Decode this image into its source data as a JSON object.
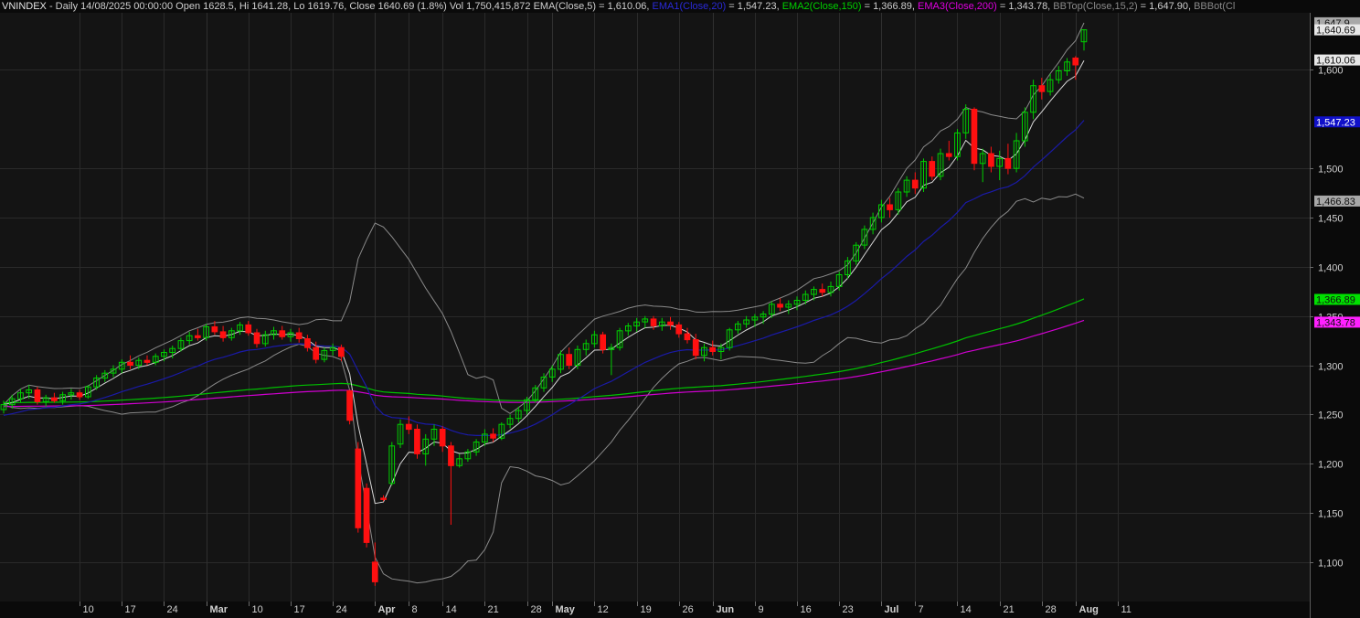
{
  "header": {
    "symbol": "VNINDEX",
    "info": " - Daily 14/08/2025 00:00:00 Open 1628.5, Hi 1641.28, Lo 1619.76, Close 1640.69 (1.8%) Vol 1,750,415,872 ",
    "ind1_label": "EMA(Close,5)",
    "ind1_value": " = 1,610.06, ",
    "ind2_label": "EMA1(Close,20)",
    "ind2_value": " = 1,547.23, ",
    "ind3_label": "EMA2(Close,150)",
    "ind3_value": " = 1,366.89, ",
    "ind4_label": "EMA3(Close,200)",
    "ind4_value": " = 1,343.78, ",
    "ind5_label": "BBTop(Close,15,2)",
    "ind5_value": " = 1,647.90, ",
    "ind6_label": "BBBot(Cl"
  },
  "colors": {
    "background": "#0a0a0a",
    "panel": "#141414",
    "grid": "#2a2a2a",
    "up": "#00d000",
    "down": "#ff1010",
    "ema5": "#d8d8d8",
    "ema20": "#1a1aa8",
    "ema150": "#00c000",
    "ema200": "#d000d0",
    "bb": "#8a8a8a",
    "axis_text": "#d0d0d0"
  },
  "chart_data": {
    "type": "candlestick",
    "y_range": [
      1060,
      1658
    ],
    "y_ticks": [
      {
        "value": 1100,
        "label": "1,100"
      },
      {
        "value": 1150,
        "label": "1,150"
      },
      {
        "value": 1200,
        "label": "1,200"
      },
      {
        "value": 1250,
        "label": "1,250"
      },
      {
        "value": 1300,
        "label": "1,300"
      },
      {
        "value": 1350,
        "label": "1,350"
      },
      {
        "value": 1400,
        "label": "1,400"
      },
      {
        "value": 1450,
        "label": "1,450"
      },
      {
        "value": 1500,
        "label": "1,500"
      },
      {
        "value": 1600,
        "label": "1,600"
      }
    ],
    "x_ticks": [
      {
        "label": "10",
        "major": false
      },
      {
        "label": "17",
        "major": false
      },
      {
        "label": "24",
        "major": false
      },
      {
        "label": "Mar",
        "major": true
      },
      {
        "label": "10",
        "major": false
      },
      {
        "label": "17",
        "major": false
      },
      {
        "label": "24",
        "major": false
      },
      {
        "label": "Apr",
        "major": true
      },
      {
        "label": "8",
        "major": false
      },
      {
        "label": "14",
        "major": false
      },
      {
        "label": "21",
        "major": false
      },
      {
        "label": "28",
        "major": false
      },
      {
        "label": "May",
        "major": true
      },
      {
        "label": "12",
        "major": false
      },
      {
        "label": "19",
        "major": false
      },
      {
        "label": "26",
        "major": false
      },
      {
        "label": "Jun",
        "major": true
      },
      {
        "label": "9",
        "major": false
      },
      {
        "label": "16",
        "major": false
      },
      {
        "label": "23",
        "major": false
      },
      {
        "label": "Jul",
        "major": true
      },
      {
        "label": "7",
        "major": false
      },
      {
        "label": "14",
        "major": false
      },
      {
        "label": "21",
        "major": false
      },
      {
        "label": "28",
        "major": false
      },
      {
        "label": "Aug",
        "major": true
      },
      {
        "label": "11",
        "major": false
      }
    ],
    "price_tags": [
      {
        "value": 1647.9,
        "label": "1,647.9",
        "color": "#a8a8a8",
        "text": "#111111"
      },
      {
        "value": 1640.69,
        "label": "1,640.69",
        "color": "#e8e8e8",
        "text": "#111111"
      },
      {
        "value": 1610.06,
        "label": "1,610.06",
        "color": "#e8e8e8",
        "text": "#111111"
      },
      {
        "value": 1547.23,
        "label": "1,547.23",
        "color": "#1010c8",
        "text": "#ffffff"
      },
      {
        "value": 1466.83,
        "label": "1,466.83",
        "color": "#a8a8a8",
        "text": "#111111"
      },
      {
        "value": 1366.89,
        "label": "1,366.89",
        "color": "#00e000",
        "text": "#111111"
      },
      {
        "value": 1343.78,
        "label": "1,343.78",
        "color": "#ff20ff",
        "text": "#111111"
      }
    ],
    "ohlc_approx": [
      [
        1255,
        1264,
        1251,
        1260
      ],
      [
        1260,
        1270,
        1256,
        1266
      ],
      [
        1266,
        1276,
        1262,
        1272
      ],
      [
        1272,
        1280,
        1266,
        1275
      ],
      [
        1275,
        1278,
        1260,
        1263
      ],
      [
        1263,
        1270,
        1258,
        1267
      ],
      [
        1267,
        1272,
        1262,
        1264
      ],
      [
        1264,
        1273,
        1260,
        1270
      ],
      [
        1270,
        1276,
        1265,
        1272
      ],
      [
        1272,
        1275,
        1265,
        1268
      ],
      [
        1268,
        1280,
        1266,
        1278
      ],
      [
        1278,
        1290,
        1275,
        1287
      ],
      [
        1287,
        1295,
        1283,
        1292
      ],
      [
        1292,
        1300,
        1288,
        1296
      ],
      [
        1296,
        1306,
        1292,
        1303
      ],
      [
        1303,
        1310,
        1296,
        1300
      ],
      [
        1300,
        1308,
        1296,
        1305
      ],
      [
        1305,
        1310,
        1300,
        1303
      ],
      [
        1303,
        1312,
        1300,
        1309
      ],
      [
        1309,
        1316,
        1304,
        1313
      ],
      [
        1313,
        1320,
        1307,
        1317
      ],
      [
        1317,
        1328,
        1314,
        1325
      ],
      [
        1325,
        1334,
        1321,
        1330
      ],
      [
        1330,
        1337,
        1325,
        1328
      ],
      [
        1328,
        1342,
        1325,
        1339
      ],
      [
        1339,
        1345,
        1331,
        1334
      ],
      [
        1334,
        1340,
        1324,
        1328
      ],
      [
        1328,
        1338,
        1325,
        1335
      ],
      [
        1335,
        1344,
        1331,
        1341
      ],
      [
        1341,
        1345,
        1330,
        1333
      ],
      [
        1333,
        1337,
        1318,
        1322
      ],
      [
        1322,
        1335,
        1319,
        1331
      ],
      [
        1331,
        1339,
        1326,
        1335
      ],
      [
        1335,
        1340,
        1326,
        1329
      ],
      [
        1329,
        1337,
        1324,
        1333
      ],
      [
        1333,
        1338,
        1323,
        1327
      ],
      [
        1327,
        1331,
        1314,
        1318
      ],
      [
        1318,
        1324,
        1302,
        1306
      ],
      [
        1306,
        1318,
        1303,
        1315
      ],
      [
        1315,
        1322,
        1310,
        1318
      ],
      [
        1318,
        1321,
        1304,
        1309
      ],
      [
        1274,
        1275,
        1240,
        1244
      ],
      [
        1215,
        1222,
        1130,
        1135
      ],
      [
        1175,
        1180,
        1115,
        1120
      ],
      [
        1100,
        1120,
        1076,
        1080
      ],
      [
        1165,
        1168,
        1162,
        1164
      ],
      [
        1180,
        1222,
        1178,
        1218
      ],
      [
        1220,
        1245,
        1216,
        1240
      ],
      [
        1240,
        1248,
        1230,
        1235
      ],
      [
        1235,
        1240,
        1205,
        1210
      ],
      [
        1210,
        1230,
        1198,
        1225
      ],
      [
        1225,
        1240,
        1218,
        1235
      ],
      [
        1235,
        1238,
        1212,
        1218
      ],
      [
        1218,
        1222,
        1138,
        1198
      ],
      [
        1198,
        1210,
        1196,
        1205
      ],
      [
        1205,
        1215,
        1202,
        1212
      ],
      [
        1212,
        1225,
        1208,
        1222
      ],
      [
        1222,
        1235,
        1218,
        1230
      ],
      [
        1230,
        1236,
        1222,
        1226
      ],
      [
        1226,
        1242,
        1224,
        1240
      ],
      [
        1240,
        1250,
        1236,
        1246
      ],
      [
        1246,
        1258,
        1242,
        1254
      ],
      [
        1254,
        1268,
        1250,
        1265
      ],
      [
        1265,
        1280,
        1262,
        1277
      ],
      [
        1277,
        1292,
        1273,
        1288
      ],
      [
        1288,
        1300,
        1283,
        1296
      ],
      [
        1296,
        1315,
        1292,
        1311
      ],
      [
        1311,
        1318,
        1296,
        1300
      ],
      [
        1300,
        1320,
        1296,
        1316
      ],
      [
        1316,
        1326,
        1310,
        1322
      ],
      [
        1322,
        1335,
        1318,
        1331
      ],
      [
        1331,
        1334,
        1312,
        1316
      ],
      [
        1316,
        1322,
        1290,
        1318
      ],
      [
        1318,
        1338,
        1315,
        1335
      ],
      [
        1335,
        1343,
        1330,
        1340
      ],
      [
        1340,
        1348,
        1334,
        1344
      ],
      [
        1344,
        1350,
        1338,
        1347
      ],
      [
        1347,
        1350,
        1336,
        1340
      ],
      [
        1340,
        1348,
        1335,
        1344
      ],
      [
        1344,
        1349,
        1336,
        1341
      ],
      [
        1341,
        1344,
        1328,
        1332
      ],
      [
        1332,
        1338,
        1322,
        1326
      ],
      [
        1326,
        1332,
        1306,
        1310
      ],
      [
        1310,
        1322,
        1304,
        1318
      ],
      [
        1318,
        1325,
        1310,
        1314
      ],
      [
        1314,
        1322,
        1306,
        1318
      ],
      [
        1318,
        1338,
        1315,
        1336
      ],
      [
        1336,
        1345,
        1332,
        1342
      ],
      [
        1342,
        1350,
        1338,
        1346
      ],
      [
        1346,
        1352,
        1339,
        1349
      ],
      [
        1349,
        1355,
        1342,
        1352
      ],
      [
        1352,
        1365,
        1348,
        1362
      ],
      [
        1362,
        1368,
        1355,
        1359
      ],
      [
        1359,
        1366,
        1352,
        1362
      ],
      [
        1362,
        1370,
        1356,
        1366
      ],
      [
        1366,
        1376,
        1362,
        1372
      ],
      [
        1372,
        1380,
        1366,
        1377
      ],
      [
        1377,
        1383,
        1370,
        1374
      ],
      [
        1374,
        1385,
        1370,
        1380
      ],
      [
        1380,
        1395,
        1376,
        1392
      ],
      [
        1392,
        1410,
        1388,
        1406
      ],
      [
        1406,
        1425,
        1402,
        1422
      ],
      [
        1422,
        1442,
        1418,
        1438
      ],
      [
        1438,
        1455,
        1433,
        1450
      ],
      [
        1450,
        1468,
        1445,
        1463
      ],
      [
        1463,
        1470,
        1450,
        1458
      ],
      [
        1458,
        1480,
        1453,
        1476
      ],
      [
        1476,
        1492,
        1471,
        1488
      ],
      [
        1488,
        1496,
        1474,
        1480
      ],
      [
        1480,
        1510,
        1476,
        1507
      ],
      [
        1507,
        1512,
        1488,
        1492
      ],
      [
        1492,
        1520,
        1488,
        1515
      ],
      [
        1515,
        1528,
        1508,
        1512
      ],
      [
        1512,
        1540,
        1508,
        1536
      ],
      [
        1536,
        1565,
        1530,
        1560
      ],
      [
        1560,
        1562,
        1498,
        1505
      ],
      [
        1505,
        1520,
        1486,
        1515
      ],
      [
        1515,
        1522,
        1496,
        1502
      ],
      [
        1502,
        1518,
        1488,
        1510
      ],
      [
        1510,
        1525,
        1494,
        1500
      ],
      [
        1500,
        1536,
        1496,
        1528
      ],
      [
        1528,
        1562,
        1522,
        1557
      ],
      [
        1557,
        1590,
        1550,
        1584
      ],
      [
        1584,
        1592,
        1570,
        1578
      ],
      [
        1578,
        1596,
        1574,
        1590
      ],
      [
        1590,
        1604,
        1586,
        1599
      ],
      [
        1599,
        1612,
        1594,
        1608
      ],
      [
        1612,
        1614,
        1590,
        1605
      ],
      [
        1628.5,
        1641.28,
        1619.76,
        1640.69
      ]
    ]
  }
}
